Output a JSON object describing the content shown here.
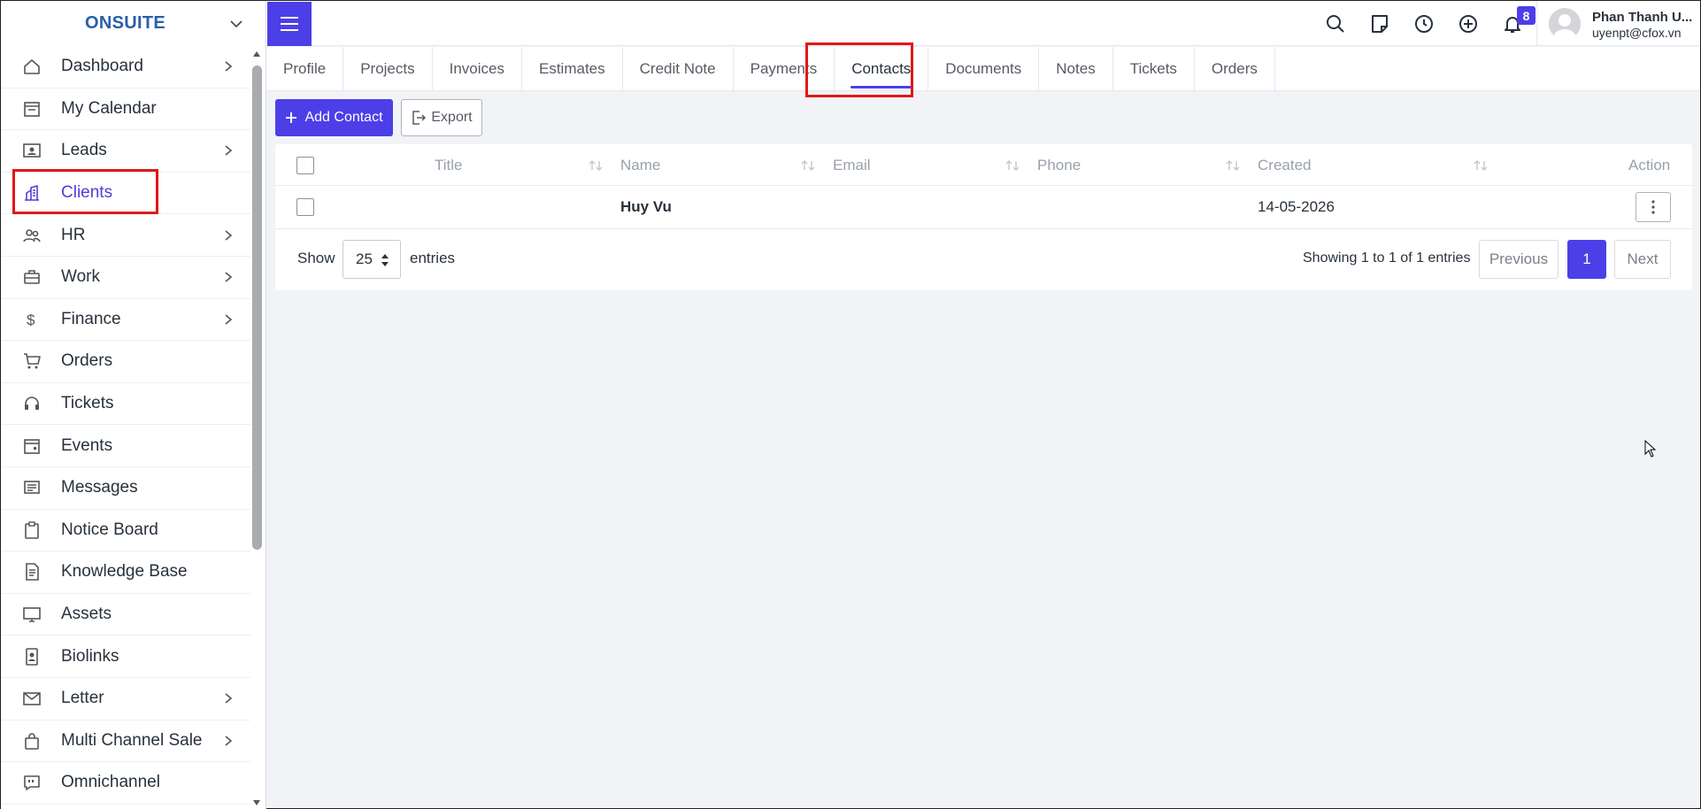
{
  "brand": {
    "name": "ONSUITE"
  },
  "sidebar": {
    "items": [
      {
        "label": "Dashboard",
        "icon": "home-icon",
        "has_arrow": true
      },
      {
        "label": "My Calendar",
        "icon": "calendar-icon",
        "has_arrow": false
      },
      {
        "label": "Leads",
        "icon": "id-card-icon",
        "has_arrow": true
      },
      {
        "label": "Clients",
        "icon": "building-icon",
        "has_arrow": false,
        "active": true
      },
      {
        "label": "HR",
        "icon": "people-icon",
        "has_arrow": true
      },
      {
        "label": "Work",
        "icon": "briefcase-icon",
        "has_arrow": true
      },
      {
        "label": "Finance",
        "icon": "dollar-icon",
        "has_arrow": true
      },
      {
        "label": "Orders",
        "icon": "cart-icon",
        "has_arrow": false
      },
      {
        "label": "Tickets",
        "icon": "headset-icon",
        "has_arrow": false
      },
      {
        "label": "Events",
        "icon": "calendar-event-icon",
        "has_arrow": false
      },
      {
        "label": "Messages",
        "icon": "message-icon",
        "has_arrow": false
      },
      {
        "label": "Notice Board",
        "icon": "clipboard-icon",
        "has_arrow": false
      },
      {
        "label": "Knowledge Base",
        "icon": "document-icon",
        "has_arrow": false
      },
      {
        "label": "Assets",
        "icon": "monitor-icon",
        "has_arrow": false
      },
      {
        "label": "Biolinks",
        "icon": "badge-icon",
        "has_arrow": false
      },
      {
        "label": "Letter",
        "icon": "envelope-icon",
        "has_arrow": true
      },
      {
        "label": "Multi Channel Sale",
        "icon": "bag-icon",
        "has_arrow": true
      },
      {
        "label": "Omnichannel",
        "icon": "chat-quote-icon",
        "has_arrow": false
      }
    ]
  },
  "header": {
    "notification_count": "8",
    "user": {
      "name": "Phan Thanh U...",
      "email": "uyenpt@cfox.vn"
    }
  },
  "tabs": [
    {
      "label": "Profile"
    },
    {
      "label": "Projects"
    },
    {
      "label": "Invoices"
    },
    {
      "label": "Estimates"
    },
    {
      "label": "Credit Note"
    },
    {
      "label": "Payments"
    },
    {
      "label": "Contacts",
      "active": true
    },
    {
      "label": "Documents"
    },
    {
      "label": "Notes"
    },
    {
      "label": "Tickets"
    },
    {
      "label": "Orders"
    }
  ],
  "actions": {
    "add_contact": "Add Contact",
    "export": "Export"
  },
  "table": {
    "columns": [
      "Title",
      "Name",
      "Email",
      "Phone",
      "Created",
      "Action"
    ],
    "rows": [
      {
        "title": "",
        "name": "Huy Vu",
        "email": "",
        "phone": "",
        "created": "14-05-2026"
      }
    ]
  },
  "footer": {
    "show_label": "Show",
    "page_size": "25",
    "entries_label": "entries",
    "info": "Showing 1 to 1 of 1 entries",
    "previous": "Previous",
    "current_page": "1",
    "next": "Next"
  },
  "colors": {
    "accent": "#4c3fe8",
    "highlight": "#e01818",
    "brand": "#2a5fa8"
  }
}
